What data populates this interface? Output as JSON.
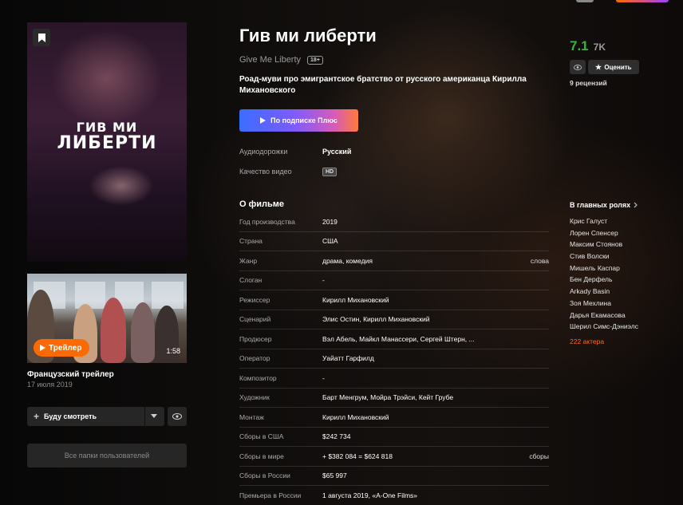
{
  "film": {
    "title": "Гив ми либерти",
    "original_title": "Give Me Liberty",
    "age_rating": "18+",
    "description": "Роад-муви про эмигрантское братство от русского американца Кирилла Михановского",
    "poster_title_line1": "ГИВ МИ",
    "poster_title_line2": "ЛИБЕРТИ"
  },
  "subscribe_button": "По подписке Плюс",
  "meta": {
    "audio_label": "Аудиодорожки",
    "audio_value": "Русский",
    "quality_label": "Качество видео",
    "quality_value": "HD"
  },
  "about": {
    "heading": "О фильме",
    "rows": [
      {
        "key": "Год производства",
        "value": "2019",
        "extra": ""
      },
      {
        "key": "Страна",
        "value": "США",
        "extra": ""
      },
      {
        "key": "Жанр",
        "value": "драма, комедия",
        "extra": "слова"
      },
      {
        "key": "Слоган",
        "value": "-",
        "extra": ""
      },
      {
        "key": "Режиссер",
        "value": "Кирилл Михановский",
        "extra": ""
      },
      {
        "key": "Сценарий",
        "value": "Элис Остин, Кирилл Михановский",
        "extra": ""
      },
      {
        "key": "Продюсер",
        "value": "Вэл Абель, Майкл Манассери, Сергей Штерн, ...",
        "extra": ""
      },
      {
        "key": "Оператор",
        "value": "Уайатт Гарфилд",
        "extra": ""
      },
      {
        "key": "Композитор",
        "value": "-",
        "extra": ""
      },
      {
        "key": "Художник",
        "value": "Барт Менгрум, Мойра Трэйси, Кейт Грубе",
        "extra": ""
      },
      {
        "key": "Монтаж",
        "value": "Кирилл Михановский",
        "extra": ""
      },
      {
        "key": "Сборы в США",
        "value": "$242 734",
        "extra": ""
      },
      {
        "key": "Сборы в мире",
        "value": "+ $382 084 = $624 818",
        "extra": "сборы"
      },
      {
        "key": "Сборы в России",
        "value": "$65 997",
        "extra": ""
      },
      {
        "key": "Премьера в России",
        "value": "1 августа 2019, «A-One Films»",
        "extra": ""
      }
    ]
  },
  "rating": {
    "score": "7.1",
    "votes": "7K",
    "rate_button": "Оценить",
    "reviews": "9 рецензий",
    "score_color": "#3bb33b"
  },
  "cast": {
    "heading": "В главных ролях",
    "names": [
      "Крис Галуст",
      "Лорен Спенсер",
      "Максим Стоянов",
      "Стив Волски",
      "Мишель Каспар",
      "Бен Дерфель",
      "Arkady Basin",
      "Зоя Мехлина",
      "Дарья Екамасова",
      "Шерил Симс-Дэниэлс"
    ],
    "more": "222 актера"
  },
  "trailer": {
    "button": "Трейлер",
    "duration": "1:58",
    "title": "Французский трейлер",
    "date": "17 июля 2019"
  },
  "actions": {
    "watch_later": "Буду смотреть",
    "user_folders": "Все папки пользователей"
  },
  "icons": {
    "bookmark": "bookmark-icon",
    "play": "play-icon",
    "eye": "eye-icon",
    "star": "star-icon",
    "plus": "plus-icon",
    "chevron": "chevron-right-icon"
  },
  "colors": {
    "accent_orange": "#ff6a00"
  }
}
